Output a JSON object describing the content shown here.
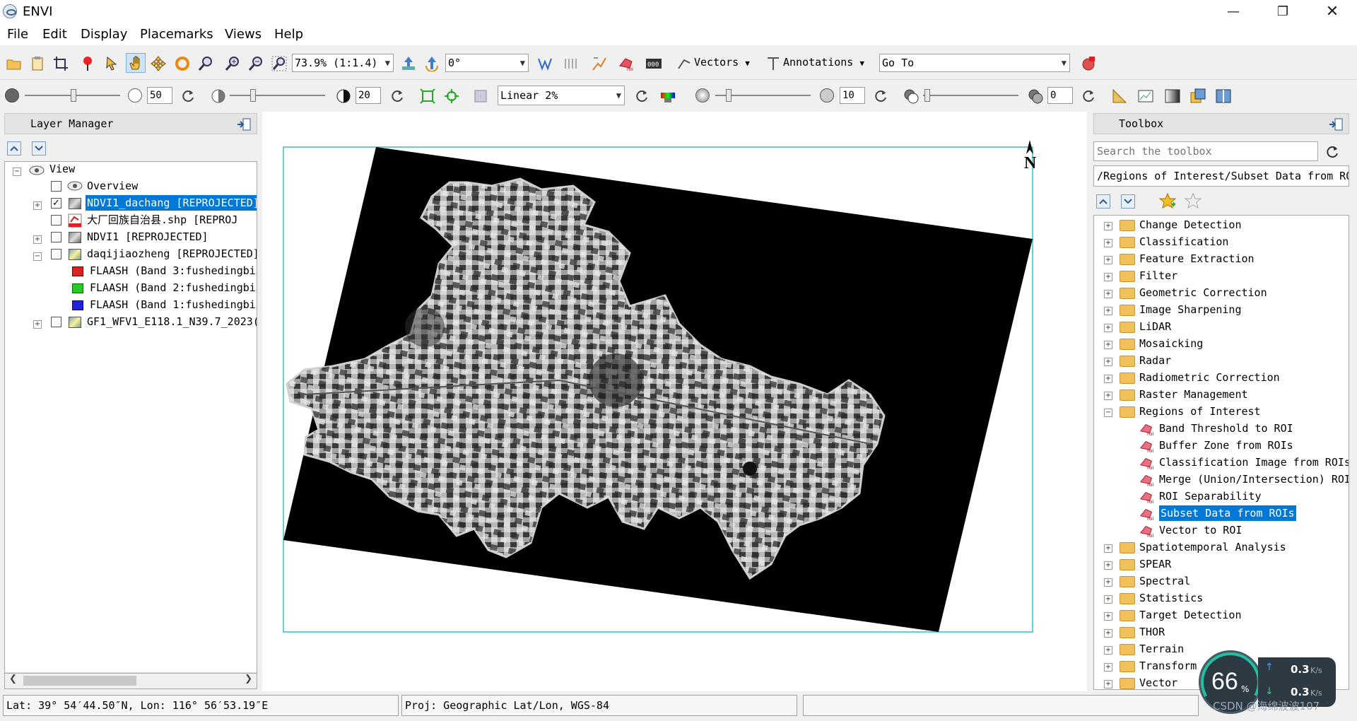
{
  "window": {
    "title": "ENVI"
  },
  "menu": [
    "File",
    "Edit",
    "Display",
    "Placemarks",
    "Views",
    "Help"
  ],
  "toolbar": {
    "zoom_value": "73.9% (1:1.4)",
    "rotation_value": "0°",
    "vectors_label": "Vectors",
    "annotations_label": "Annotations",
    "goto_value": "Go To",
    "brightness_value": "50",
    "contrast_value": "20",
    "stretch_value": "Linear 2%",
    "sharpen_value": "10",
    "transparency_value": "0"
  },
  "layer_manager": {
    "title": "Layer Manager",
    "items": [
      {
        "label": "View"
      },
      {
        "label": "Overview"
      },
      {
        "label": "NDVI1_dachang [REPROJECTED]"
      },
      {
        "label": "大厂回族自治县.shp [REPROJ"
      },
      {
        "label": "NDVI1 [REPROJECTED]"
      },
      {
        "label": "daqijiaozheng [REPROJECTED]"
      },
      {
        "label": "FLAASH (Band 3:fushedingbi"
      },
      {
        "label": "FLAASH (Band 2:fushedingbi"
      },
      {
        "label": "FLAASH (Band 1:fushedingbi"
      },
      {
        "label": "GF1_WFV1_E118.1_N39.7_2023("
      }
    ]
  },
  "view": {
    "north_label": "N"
  },
  "toolbox": {
    "title": "Toolbox",
    "search_placeholder": "Search the toolbox",
    "path": "/Regions of Interest/Subset Data from ROIs",
    "folders_top": [
      "Change Detection",
      "Classification",
      "Feature Extraction",
      "Filter",
      "Geometric Correction",
      "Image Sharpening",
      "LiDAR",
      "Mosaicking",
      "Radar",
      "Radiometric Correction",
      "Raster Management",
      "Regions of Interest"
    ],
    "roi_tools": [
      "Band Threshold to ROI",
      "Buffer Zone from ROIs",
      "Classification Image from ROIs",
      "Merge (Union/Intersection) ROI",
      "ROI Separability",
      "Subset Data from ROIs",
      "Vector to ROI"
    ],
    "folders_bottom": [
      "Spatiotemporal Analysis",
      "SPEAR",
      "Spectral",
      "Statistics",
      "Target Detection",
      "THOR",
      "Terrain",
      "Transform",
      "Vector"
    ]
  },
  "status": {
    "latlon": "Lat: 39° 54′44.50″N, Lon: 116° 56′53.19″E",
    "projection": "Proj: Geographic Lat/Lon, WGS-84"
  },
  "overlay": {
    "percent": "66",
    "percent_unit": "%",
    "up_speed": "0.3",
    "down_speed": "0.3",
    "speed_unit": "K/s",
    "watermark": "CSDN @海绵波波107"
  }
}
